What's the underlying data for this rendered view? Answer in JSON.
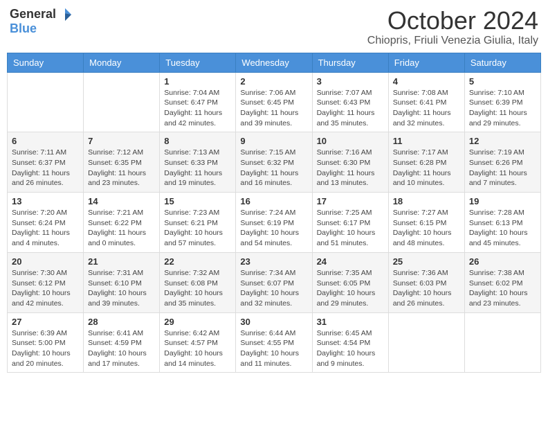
{
  "header": {
    "logo_general": "General",
    "logo_blue": "Blue",
    "month_title": "October 2024",
    "location": "Chiopris, Friuli Venezia Giulia, Italy"
  },
  "weekdays": [
    "Sunday",
    "Monday",
    "Tuesday",
    "Wednesday",
    "Thursday",
    "Friday",
    "Saturday"
  ],
  "weeks": [
    [
      {
        "day": "",
        "sunrise": "",
        "sunset": "",
        "daylight": ""
      },
      {
        "day": "",
        "sunrise": "",
        "sunset": "",
        "daylight": ""
      },
      {
        "day": "1",
        "sunrise": "Sunrise: 7:04 AM",
        "sunset": "Sunset: 6:47 PM",
        "daylight": "Daylight: 11 hours and 42 minutes."
      },
      {
        "day": "2",
        "sunrise": "Sunrise: 7:06 AM",
        "sunset": "Sunset: 6:45 PM",
        "daylight": "Daylight: 11 hours and 39 minutes."
      },
      {
        "day": "3",
        "sunrise": "Sunrise: 7:07 AM",
        "sunset": "Sunset: 6:43 PM",
        "daylight": "Daylight: 11 hours and 35 minutes."
      },
      {
        "day": "4",
        "sunrise": "Sunrise: 7:08 AM",
        "sunset": "Sunset: 6:41 PM",
        "daylight": "Daylight: 11 hours and 32 minutes."
      },
      {
        "day": "5",
        "sunrise": "Sunrise: 7:10 AM",
        "sunset": "Sunset: 6:39 PM",
        "daylight": "Daylight: 11 hours and 29 minutes."
      }
    ],
    [
      {
        "day": "6",
        "sunrise": "Sunrise: 7:11 AM",
        "sunset": "Sunset: 6:37 PM",
        "daylight": "Daylight: 11 hours and 26 minutes."
      },
      {
        "day": "7",
        "sunrise": "Sunrise: 7:12 AM",
        "sunset": "Sunset: 6:35 PM",
        "daylight": "Daylight: 11 hours and 23 minutes."
      },
      {
        "day": "8",
        "sunrise": "Sunrise: 7:13 AM",
        "sunset": "Sunset: 6:33 PM",
        "daylight": "Daylight: 11 hours and 19 minutes."
      },
      {
        "day": "9",
        "sunrise": "Sunrise: 7:15 AM",
        "sunset": "Sunset: 6:32 PM",
        "daylight": "Daylight: 11 hours and 16 minutes."
      },
      {
        "day": "10",
        "sunrise": "Sunrise: 7:16 AM",
        "sunset": "Sunset: 6:30 PM",
        "daylight": "Daylight: 11 hours and 13 minutes."
      },
      {
        "day": "11",
        "sunrise": "Sunrise: 7:17 AM",
        "sunset": "Sunset: 6:28 PM",
        "daylight": "Daylight: 11 hours and 10 minutes."
      },
      {
        "day": "12",
        "sunrise": "Sunrise: 7:19 AM",
        "sunset": "Sunset: 6:26 PM",
        "daylight": "Daylight: 11 hours and 7 minutes."
      }
    ],
    [
      {
        "day": "13",
        "sunrise": "Sunrise: 7:20 AM",
        "sunset": "Sunset: 6:24 PM",
        "daylight": "Daylight: 11 hours and 4 minutes."
      },
      {
        "day": "14",
        "sunrise": "Sunrise: 7:21 AM",
        "sunset": "Sunset: 6:22 PM",
        "daylight": "Daylight: 11 hours and 0 minutes."
      },
      {
        "day": "15",
        "sunrise": "Sunrise: 7:23 AM",
        "sunset": "Sunset: 6:21 PM",
        "daylight": "Daylight: 10 hours and 57 minutes."
      },
      {
        "day": "16",
        "sunrise": "Sunrise: 7:24 AM",
        "sunset": "Sunset: 6:19 PM",
        "daylight": "Daylight: 10 hours and 54 minutes."
      },
      {
        "day": "17",
        "sunrise": "Sunrise: 7:25 AM",
        "sunset": "Sunset: 6:17 PM",
        "daylight": "Daylight: 10 hours and 51 minutes."
      },
      {
        "day": "18",
        "sunrise": "Sunrise: 7:27 AM",
        "sunset": "Sunset: 6:15 PM",
        "daylight": "Daylight: 10 hours and 48 minutes."
      },
      {
        "day": "19",
        "sunrise": "Sunrise: 7:28 AM",
        "sunset": "Sunset: 6:13 PM",
        "daylight": "Daylight: 10 hours and 45 minutes."
      }
    ],
    [
      {
        "day": "20",
        "sunrise": "Sunrise: 7:30 AM",
        "sunset": "Sunset: 6:12 PM",
        "daylight": "Daylight: 10 hours and 42 minutes."
      },
      {
        "day": "21",
        "sunrise": "Sunrise: 7:31 AM",
        "sunset": "Sunset: 6:10 PM",
        "daylight": "Daylight: 10 hours and 39 minutes."
      },
      {
        "day": "22",
        "sunrise": "Sunrise: 7:32 AM",
        "sunset": "Sunset: 6:08 PM",
        "daylight": "Daylight: 10 hours and 35 minutes."
      },
      {
        "day": "23",
        "sunrise": "Sunrise: 7:34 AM",
        "sunset": "Sunset: 6:07 PM",
        "daylight": "Daylight: 10 hours and 32 minutes."
      },
      {
        "day": "24",
        "sunrise": "Sunrise: 7:35 AM",
        "sunset": "Sunset: 6:05 PM",
        "daylight": "Daylight: 10 hours and 29 minutes."
      },
      {
        "day": "25",
        "sunrise": "Sunrise: 7:36 AM",
        "sunset": "Sunset: 6:03 PM",
        "daylight": "Daylight: 10 hours and 26 minutes."
      },
      {
        "day": "26",
        "sunrise": "Sunrise: 7:38 AM",
        "sunset": "Sunset: 6:02 PM",
        "daylight": "Daylight: 10 hours and 23 minutes."
      }
    ],
    [
      {
        "day": "27",
        "sunrise": "Sunrise: 6:39 AM",
        "sunset": "Sunset: 5:00 PM",
        "daylight": "Daylight: 10 hours and 20 minutes."
      },
      {
        "day": "28",
        "sunrise": "Sunrise: 6:41 AM",
        "sunset": "Sunset: 4:59 PM",
        "daylight": "Daylight: 10 hours and 17 minutes."
      },
      {
        "day": "29",
        "sunrise": "Sunrise: 6:42 AM",
        "sunset": "Sunset: 4:57 PM",
        "daylight": "Daylight: 10 hours and 14 minutes."
      },
      {
        "day": "30",
        "sunrise": "Sunrise: 6:44 AM",
        "sunset": "Sunset: 4:55 PM",
        "daylight": "Daylight: 10 hours and 11 minutes."
      },
      {
        "day": "31",
        "sunrise": "Sunrise: 6:45 AM",
        "sunset": "Sunset: 4:54 PM",
        "daylight": "Daylight: 10 hours and 9 minutes."
      },
      {
        "day": "",
        "sunrise": "",
        "sunset": "",
        "daylight": ""
      },
      {
        "day": "",
        "sunrise": "",
        "sunset": "",
        "daylight": ""
      }
    ]
  ]
}
